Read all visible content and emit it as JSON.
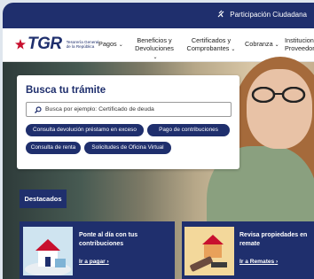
{
  "topbar": {
    "link": "Participación Ciudadana"
  },
  "logo": {
    "name": "TGR",
    "subtitle": "Tesorería General de la República"
  },
  "nav": [
    {
      "label": "Pagos"
    },
    {
      "label": "Beneficios y Devoluciones"
    },
    {
      "label": "Certificados y Comprobantes"
    },
    {
      "label": "Cobranza"
    },
    {
      "label": "Institucion Proveedor"
    }
  ],
  "search_card": {
    "title": "Busca tu trámite",
    "placeholder": "Busca por ejemplo: Certificado de deuda",
    "chips": [
      "Consulta devolución préstamo en exceso",
      "Pago de contribuciones",
      "Consulta de renta",
      "Solicitudes de Oficina Virtual"
    ]
  },
  "featured": {
    "label": "Destacados",
    "items": [
      {
        "title": "Ponte al día con tus contribuciones",
        "link": "Ir a pagar"
      },
      {
        "title": "Revisa propiedades en remate",
        "link": "Ir a Remates"
      }
    ]
  },
  "colors": {
    "brand": "#1f2f6d",
    "accent": "#c8102e"
  }
}
